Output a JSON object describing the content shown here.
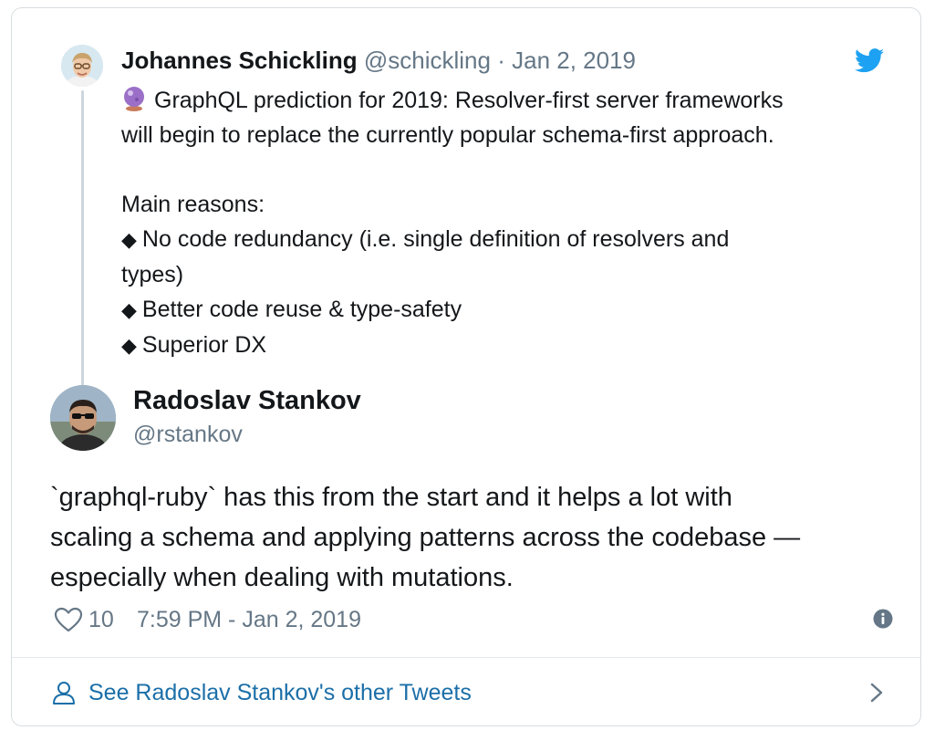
{
  "quoted_tweet": {
    "author_name": "Johannes Schickling",
    "handle": "@schickling",
    "separator": "·",
    "date": "Jan 2, 2019",
    "text_line1": "GraphQL prediction for 2019: Resolver-first server frameworks",
    "text_line2": "will begin to replace the currently popular schema-first approach.",
    "reasons_heading": "Main reasons:",
    "reason1_line1": "No code redundancy (i.e. single definition of resolvers and",
    "reason1_line2": "types)",
    "reason2": "Better code reuse & type-safety",
    "reason3": "Superior DX",
    "bullet": "◆",
    "emoji_icon": "crystal-ball-icon"
  },
  "tweet": {
    "author_name": "Radoslav Stankov",
    "handle": "@rstankov",
    "text_line1": "`graphql-ruby` has this from the start and it helps a lot with",
    "text_line2": "scaling a schema and applying patterns across the codebase —",
    "text_line3": "especially when dealing with mutations.",
    "likes": "10",
    "timestamp": "7:59 PM - Jan 2, 2019"
  },
  "footer": {
    "link_label": "See Radoslav Stankov's other Tweets"
  },
  "colors": {
    "twitter_blue": "#1da1f2",
    "link_blue": "#1b6fa8",
    "secondary_text": "#657786",
    "border": "#d8dde1"
  }
}
